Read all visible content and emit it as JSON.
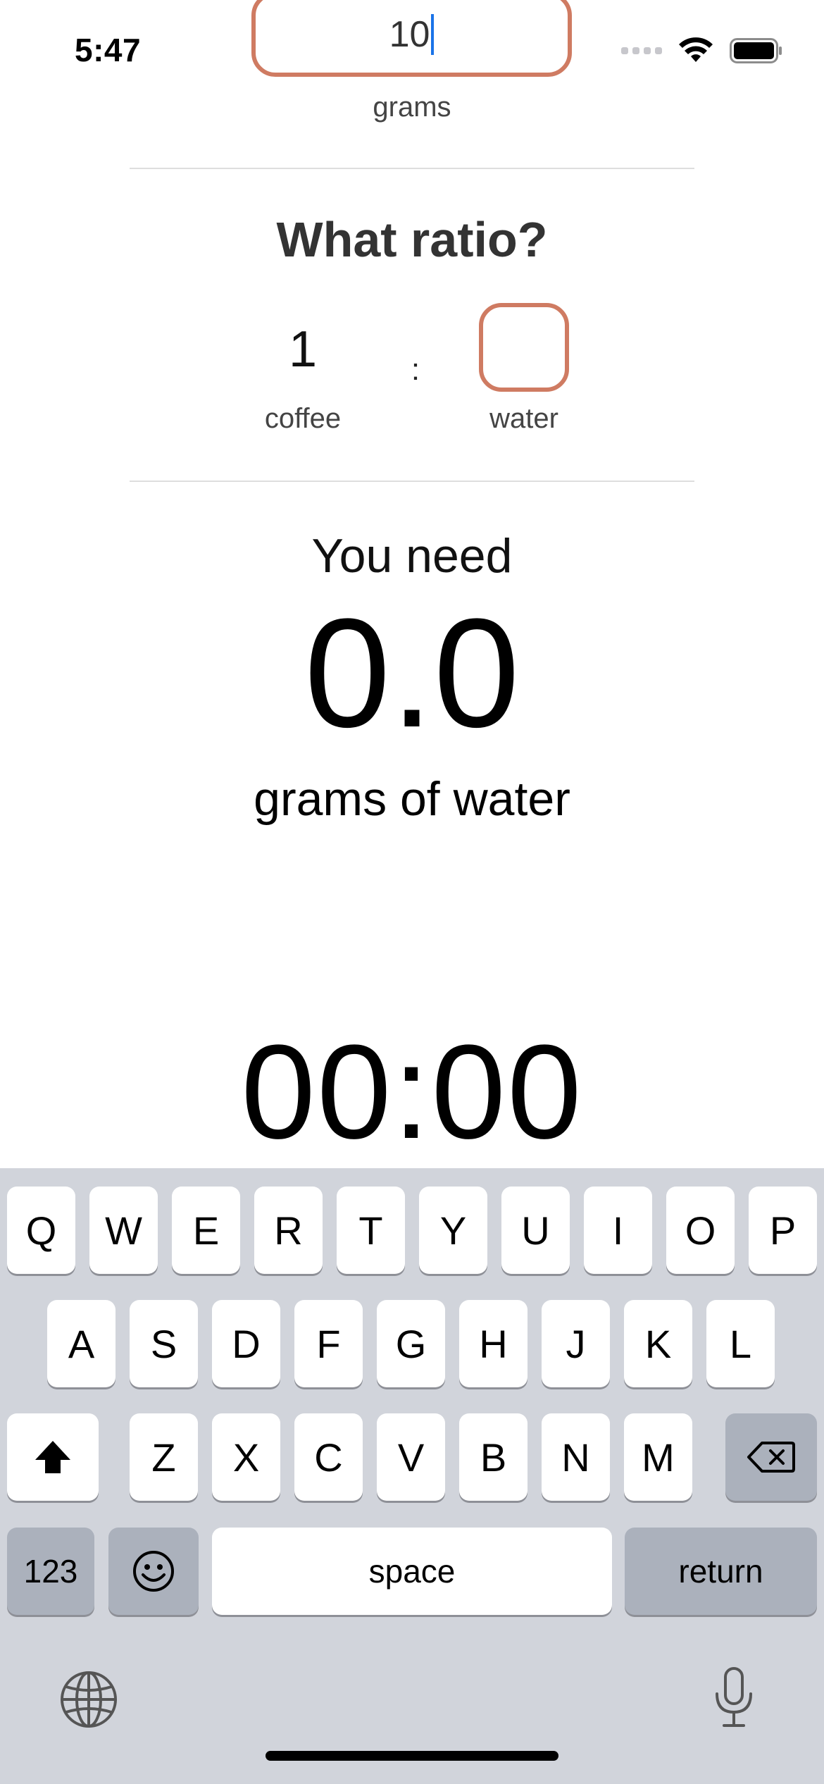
{
  "status_bar": {
    "time": "5:47"
  },
  "coffee": {
    "value": "10",
    "unit_label": "grams"
  },
  "ratio": {
    "title": "What ratio?",
    "coffee_value": "1",
    "coffee_label": "coffee",
    "separator": ":",
    "water_value": "",
    "water_label": "water"
  },
  "result": {
    "prefix": "You need",
    "value": "0.0",
    "unit": "grams of water"
  },
  "timer": {
    "display": "00:00"
  },
  "keyboard": {
    "row1": [
      "Q",
      "W",
      "E",
      "R",
      "T",
      "Y",
      "U",
      "I",
      "O",
      "P"
    ],
    "row2": [
      "A",
      "S",
      "D",
      "F",
      "G",
      "H",
      "J",
      "K",
      "L"
    ],
    "row3": [
      "Z",
      "X",
      "C",
      "V",
      "B",
      "N",
      "M"
    ],
    "numbers_label": "123",
    "space_label": "space",
    "return_label": "return"
  },
  "colors": {
    "accent_border": "#cf7b62",
    "caret": "#1a73e8",
    "keyboard_bg": "#d1d4db"
  }
}
